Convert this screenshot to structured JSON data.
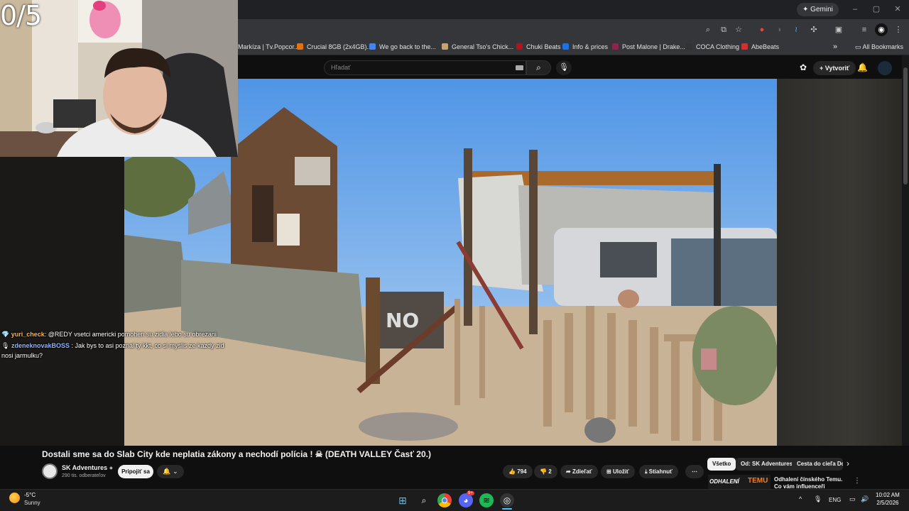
{
  "stream_overlay": {
    "counter": "0/5",
    "chat": [
      {
        "badge": "💎",
        "user": "yuri_check",
        "user_color": "#ffb347",
        "text": ": @REDY vsetci americki pomoheri su zidia lebo su obrezani"
      },
      {
        "badge": "🎙",
        "user": "zdeneknovakBOSS",
        "user_color": "#8fb4ff",
        "text": ": Jak bys to asi poznal ty kkt, co si myslis ze kazdy zid nosi jarmulku?"
      }
    ]
  },
  "browser": {
    "gemini_label": "Gemini",
    "bookmarks": [
      {
        "label": "Markíza | Tv.Popcor...",
        "color": "#d93025"
      },
      {
        "label": "Crucial 8GB (2x4GB)...",
        "color": "#e8710a"
      },
      {
        "label": "We go back to the...",
        "color": "#4285f4"
      },
      {
        "label": "General Tso's Chick...",
        "color": "#c5a46d"
      },
      {
        "label": "Chuki Beats",
        "color": "#b80f1a"
      },
      {
        "label": "Info & prices",
        "color": "#1a73e8"
      },
      {
        "label": "Post Malone | Drake...",
        "color": "#8e244d"
      },
      {
        "label": "COCA Clothing",
        "color": "#333333"
      },
      {
        "label": "AbeBeats",
        "color": "#d32f2f"
      }
    ],
    "bookmarks_more": "»",
    "all_bookmarks": "All Bookmarks"
  },
  "youtube": {
    "search_placeholder": "Hľadať",
    "create_label": "Vytvoriť",
    "video_title": "Dostali sme sa do Slab City kde neplatia zákony a nechodí polícia ! ☠ (DEATH VALLEY Časť 20.)",
    "channel_name": "SK Adventures",
    "subscribers": "290 tis. odberateľov",
    "join_label": "Pripojiť sa",
    "likes": "794",
    "dislikes": "2",
    "share_label": "Zdieľať",
    "save_label": "Uložiť",
    "download_label": "Stiahnuť",
    "chips": [
      "Všetko",
      "Od: SK Adventures",
      "Cesta do cieľa Do"
    ],
    "rec_title": "Odhalení čínského Temu. Co vám influenceři neřeknou?",
    "rec_thumb_text": "ODHALENÍ",
    "rec_thumb_brand": "TEMU"
  },
  "taskbar": {
    "temperature": "-5°C",
    "weather": "Sunny",
    "language": "ENG",
    "time": "10:02 AM",
    "date": "2/5/2026",
    "discord_badge": "9+"
  }
}
